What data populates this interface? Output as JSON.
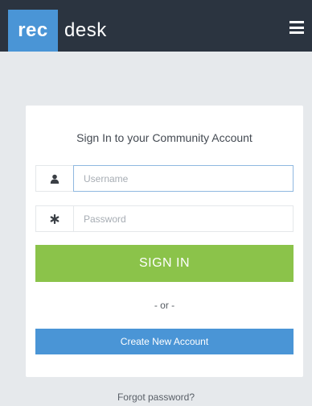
{
  "header": {
    "logo_rec": "rec",
    "logo_desk": "desk",
    "menu_icon": "hamburger-menu-icon"
  },
  "login": {
    "title": "Sign In to your Community Account",
    "username": {
      "placeholder": "Username",
      "value": "",
      "icon": "user-icon"
    },
    "password": {
      "placeholder": "Password",
      "value": "",
      "icon": "asterisk-icon"
    },
    "signin_label": "SIGN IN",
    "or_text": "- or -",
    "create_label": "Create New Account",
    "forgot_label": "Forgot password?"
  },
  "colors": {
    "navbar": "#2b3440",
    "brand_blue": "#4a95d6",
    "signin_green": "#8bc34a",
    "page_bg": "#e6e9ec"
  }
}
